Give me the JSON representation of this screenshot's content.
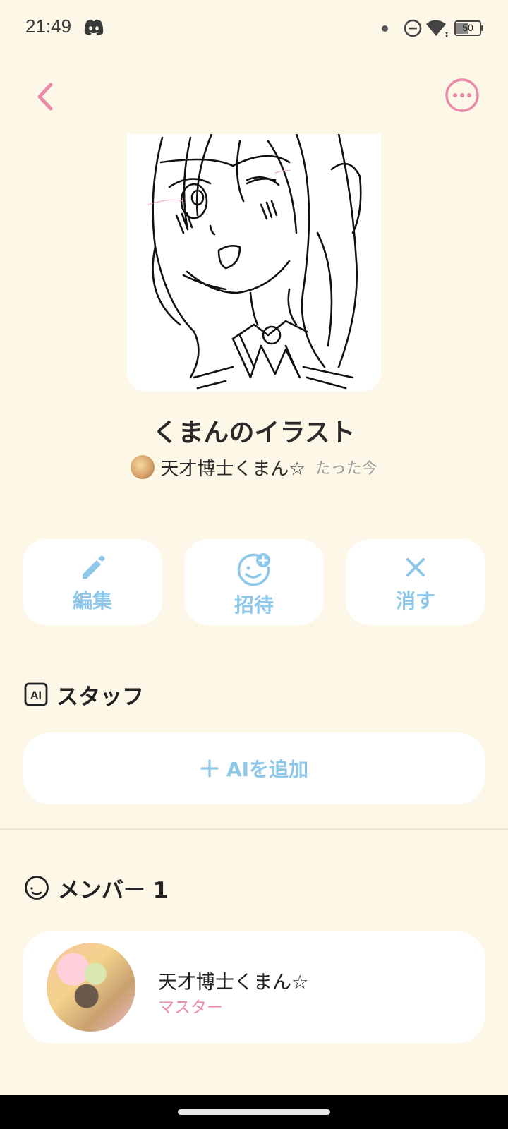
{
  "status_bar": {
    "time": "21:49",
    "battery": "50",
    "icons": [
      "discord-icon",
      "dot-icon",
      "do-not-disturb-icon",
      "wifi-icon",
      "battery-icon"
    ]
  },
  "header": {
    "back_icon": "chevron-left-icon",
    "more_icon": "more-horizontal-icon",
    "accent": "#ea8aa8"
  },
  "room": {
    "title": "くまんのイラスト",
    "owner_name": "天才博士くまん☆",
    "timestamp": "たった今"
  },
  "actions": [
    {
      "label": "編集",
      "icon": "pencil-icon"
    },
    {
      "label": "招待",
      "icon": "add-person-icon"
    },
    {
      "label": "消す",
      "icon": "close-icon"
    }
  ],
  "staff": {
    "title": "スタッフ",
    "badge": "AI",
    "add_button_label": "AIを追加"
  },
  "members": {
    "title": "メンバー 1",
    "items": [
      {
        "name": "天才博士くまん☆",
        "role": "マスター"
      }
    ]
  },
  "colors": {
    "background": "#fdf7e8",
    "action_blue": "#8dc7ea",
    "accent_pink": "#ea8aa8"
  }
}
